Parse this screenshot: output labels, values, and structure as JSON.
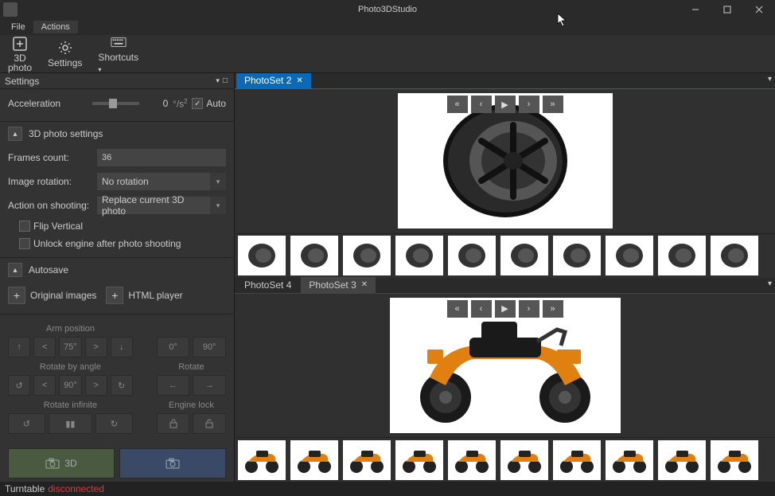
{
  "app": {
    "title": "Photo3DStudio"
  },
  "menu": {
    "file": "File",
    "actions": "Actions"
  },
  "ribbon": {
    "photo3d": "3D\nphoto",
    "settings": "Settings",
    "shortcuts": "Shortcuts"
  },
  "left": {
    "header": "Settings",
    "accel_label": "Acceleration",
    "accel_value": "0",
    "accel_unit": "°/s",
    "accel_exp": "2",
    "auto_label": "Auto",
    "auto_checked": "✓",
    "sec_3d_title": "3D photo settings",
    "frames_label": "Frames count:",
    "frames_value": "36",
    "rotation_label": "Image rotation:",
    "rotation_value": "No rotation",
    "action_label": "Action on shooting:",
    "action_value": "Replace current 3D photo",
    "flip_label": "Flip Vertical",
    "unlock_label": "Unlock engine after photo shooting",
    "autosave_title": "Autosave",
    "orig_images": "Original images",
    "html_player": "HTML player",
    "arm_position": "Arm position",
    "angle_val": "75°",
    "deg0": "0°",
    "deg90": "90°",
    "rotate_by_angle": "Rotate by angle",
    "rotate": "Rotate",
    "rot_angle": "90°",
    "rotate_infinite": "Rotate infinite",
    "engine_lock": "Engine lock",
    "btn_3d": "3D"
  },
  "tabs": {
    "set2": "PhotoSet 2",
    "set3": "PhotoSet 3",
    "set4": "PhotoSet 4"
  },
  "status": {
    "label": "Turntable",
    "value": "disconnected"
  }
}
